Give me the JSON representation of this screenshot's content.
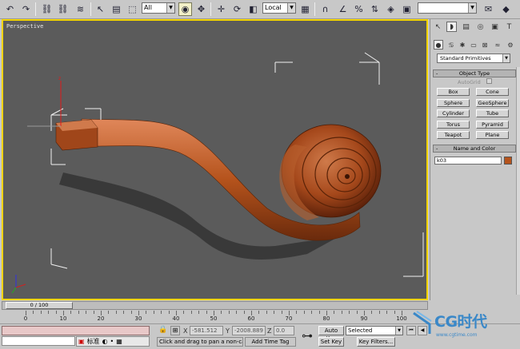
{
  "toolbar": {
    "selection_filter": "All",
    "ref_coord_system": "Local",
    "named_selection": ""
  },
  "viewport": {
    "label": "Perspective",
    "object_color": "#b5531c"
  },
  "command_panel": {
    "category": "Standard Primitives",
    "object_type_title": "Object Type",
    "autogrid_label": "AutoGrid",
    "buttons": [
      "Box",
      "Cone",
      "Sphere",
      "GeoSphere",
      "Cylinder",
      "Tube",
      "Torus",
      "Pyramid",
      "Teapot",
      "Plane"
    ],
    "name_color_title": "Name and Color",
    "object_name": "k03",
    "object_color": "#b5531c"
  },
  "timeline": {
    "frame_display": "0 / 100",
    "ticks": [
      "0",
      "10",
      "20",
      "30",
      "40",
      "50",
      "60",
      "70",
      "80",
      "90",
      "100"
    ]
  },
  "statusbar": {
    "ime_text": "标准",
    "coord_x_label": "X",
    "coord_x": "-581.512",
    "coord_y_label": "Y",
    "coord_y": "-2008.889",
    "coord_z_label": "Z",
    "coord_z": "0.0",
    "prompt": "Click and drag to pan a non-camera view",
    "add_time_tag": "Add Time Tag",
    "auto_key": "Auto Key",
    "selected": "Selected",
    "set_key": "Set Key",
    "key_filters": "Key Filters..."
  },
  "watermark": {
    "text": "CG时代",
    "sub": "www.cgtime.com"
  }
}
